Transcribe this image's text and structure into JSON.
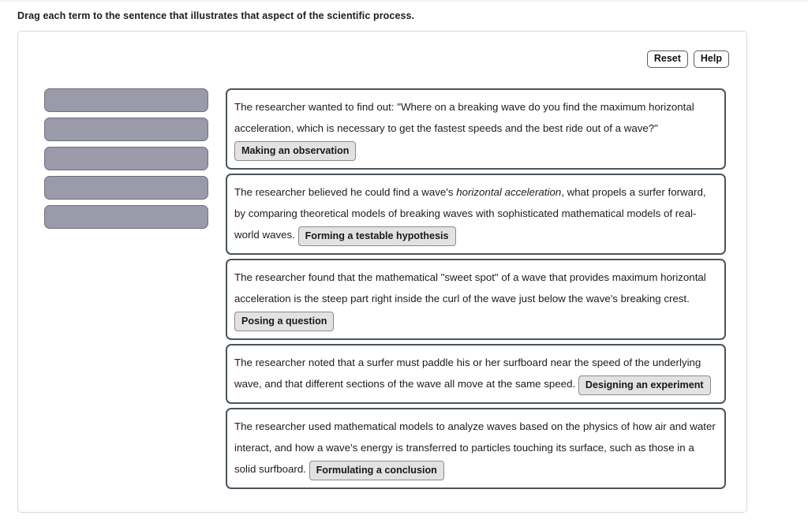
{
  "prompt": "Drag each term to the sentence that illustrates that aspect of the scientific process.",
  "toolbar": {
    "reset_label": "Reset",
    "help_label": "Help"
  },
  "colors": {
    "slot_fill": "#9a9aab",
    "slot_border": "#6f6f80",
    "sentence_border": "#4b545b",
    "chip_fill": "#e2e2e2",
    "chip_border": "#8b8b8b",
    "panel_border": "#d8d8d8"
  },
  "drop_slots": [
    {
      "index": 1,
      "value": ""
    },
    {
      "index": 2,
      "value": ""
    },
    {
      "index": 3,
      "value": ""
    },
    {
      "index": 4,
      "value": ""
    },
    {
      "index": 5,
      "value": ""
    }
  ],
  "sentences": [
    {
      "lead": "The researcher wanted to find out: \"Where on a breaking wave do you find the maximum horizontal acceleration, which is necessary to get the fastest speeds and the best ride out of a wave?\"",
      "term": "Making an observation",
      "term_inline": false
    },
    {
      "pre_italic": "The researcher believed he could find a wave's ",
      "italic": "horizontal acceleration",
      "post_italic": ", what propels a surfer forward, by comparing theoretical models of breaking waves with sophisticated mathematical models of real-world waves. ",
      "term": "Forming a testable hypothesis",
      "term_inline": true
    },
    {
      "lead": "The researcher found that the mathematical \"sweet spot\" of a wave that provides maximum horizontal acceleration is the steep part right inside the curl of the wave just below the wave's breaking crest.",
      "term": "Posing a question",
      "term_inline": false
    },
    {
      "lead": "The researcher noted that a surfer must paddle his or her surfboard near the speed of the underlying wave, and that different sections of the wave all move at the same speed.",
      "term": "Designing an experiment",
      "term_inline": false
    },
    {
      "lead": "The researcher used mathematical models to analyze waves based on the physics of how air and water interact, and how a wave's energy is transferred to particles touching its surface, such as those in a solid surfboard. ",
      "term": "Formulating a conclusion",
      "term_inline": true
    }
  ]
}
